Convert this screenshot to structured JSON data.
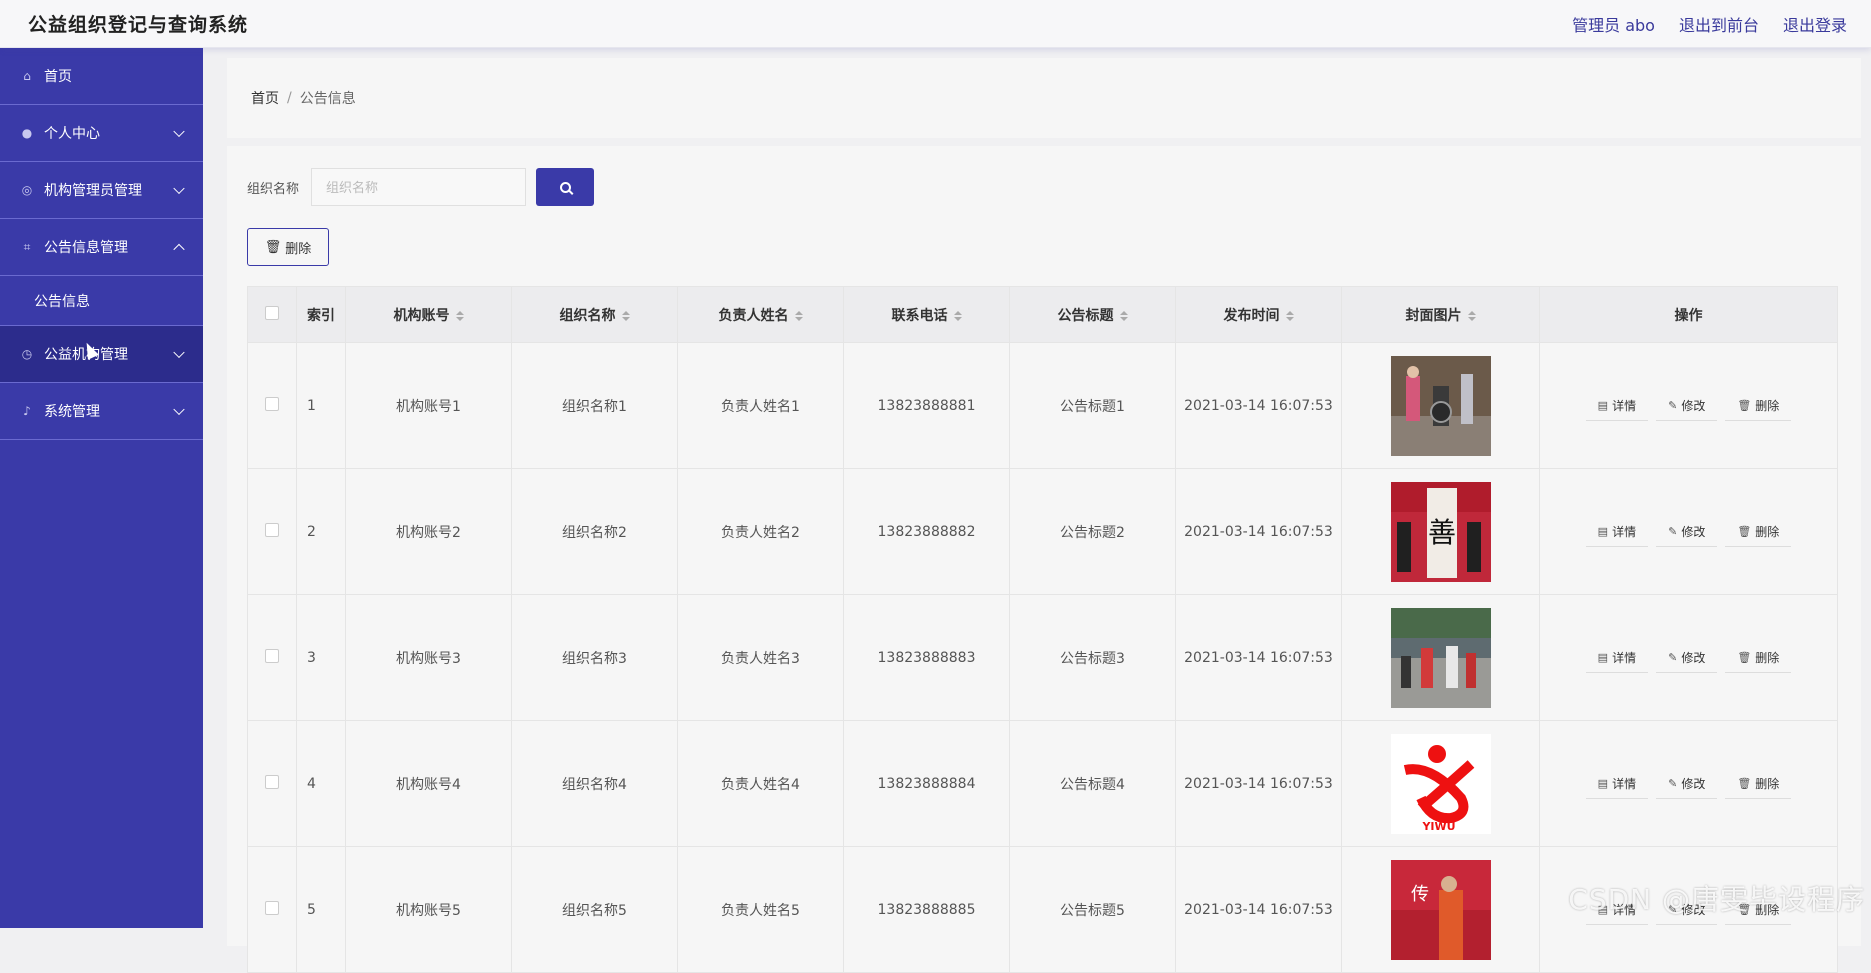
{
  "app": {
    "title": "公益组织登记与查询系统"
  },
  "topbar": {
    "admin_label": "管理员 abo",
    "front_label": "退出到前台",
    "logout_label": "退出登录"
  },
  "sidebar": {
    "items": [
      {
        "label": "首页",
        "icon": "home-icon"
      },
      {
        "label": "个人中心",
        "icon": "user-icon"
      },
      {
        "label": "机构管理员管理",
        "icon": "org-icon"
      },
      {
        "label": "公告信息管理",
        "icon": "crop-icon"
      },
      {
        "label": "公益机构管理",
        "icon": "clock-icon"
      },
      {
        "label": "系统管理",
        "icon": "mic-icon"
      }
    ],
    "sub_items": [
      {
        "label": "公告信息"
      }
    ]
  },
  "breadcrumb": {
    "home": "首页",
    "separator": "/",
    "current": "公告信息"
  },
  "search": {
    "label": "组织名称",
    "placeholder": "组织名称"
  },
  "toolbar": {
    "delete_label": "删除"
  },
  "table": {
    "headers": [
      "索引",
      "机构账号",
      "组织名称",
      "负责人姓名",
      "联系电话",
      "公告标题",
      "发布时间",
      "封面图片",
      "操作"
    ],
    "rows": [
      {
        "index": "1",
        "account": "机构账号1",
        "org": "组织名称1",
        "person": "负责人姓名1",
        "phone": "13823888881",
        "title": "公告标题1",
        "time": "2021-03-14 16:07:53"
      },
      {
        "index": "2",
        "account": "机构账号2",
        "org": "组织名称2",
        "person": "负责人姓名2",
        "phone": "13823888882",
        "title": "公告标题2",
        "time": "2021-03-14 16:07:53"
      },
      {
        "index": "3",
        "account": "机构账号3",
        "org": "组织名称3",
        "person": "负责人姓名3",
        "phone": "13823888883",
        "title": "公告标题3",
        "time": "2021-03-14 16:07:53"
      },
      {
        "index": "4",
        "account": "机构账号4",
        "org": "组织名称4",
        "person": "负责人姓名4",
        "phone": "13823888884",
        "title": "公告标题4",
        "time": "2021-03-14 16:07:53"
      },
      {
        "index": "5",
        "account": "机构账号5",
        "org": "组织名称5",
        "person": "负责人姓名5",
        "phone": "13823888885",
        "title": "公告标题5",
        "time": "2021-03-14 16:07:53"
      }
    ],
    "ops": {
      "detail": "详情",
      "edit": "修改",
      "delete": "删除"
    }
  },
  "watermark": "CSDN @唐雯毕设程序",
  "colors": {
    "sidebar": "#3a3aa8",
    "accent": "#3a3aa8"
  }
}
